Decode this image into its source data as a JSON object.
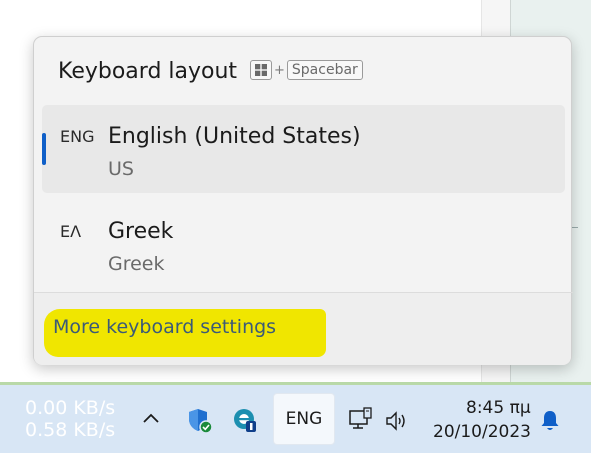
{
  "flyout": {
    "title": "Keyboard layout",
    "shortcut_plus": "+",
    "shortcut_key": "Spacebar",
    "layouts": [
      {
        "code": "ENG",
        "name": "English (United States)",
        "variant": "US",
        "selected": true
      },
      {
        "code": "ΕΛ",
        "name": "Greek",
        "variant": "Greek",
        "selected": false
      }
    ],
    "more_settings_label": "More keyboard settings",
    "highlight_color": "#f0e600",
    "accent_color": "#0f5fc8"
  },
  "taskbar": {
    "upload_speed": "0.00 KB/s",
    "download_speed": "0.58 KB/s",
    "language": "ENG",
    "time": "8:45 πμ",
    "date": "20/10/2023",
    "icons": [
      "chevron-up-icon",
      "windows-security-icon",
      "edge-beta-icon",
      "network-icon",
      "volume-icon",
      "notification-bell-icon"
    ]
  }
}
